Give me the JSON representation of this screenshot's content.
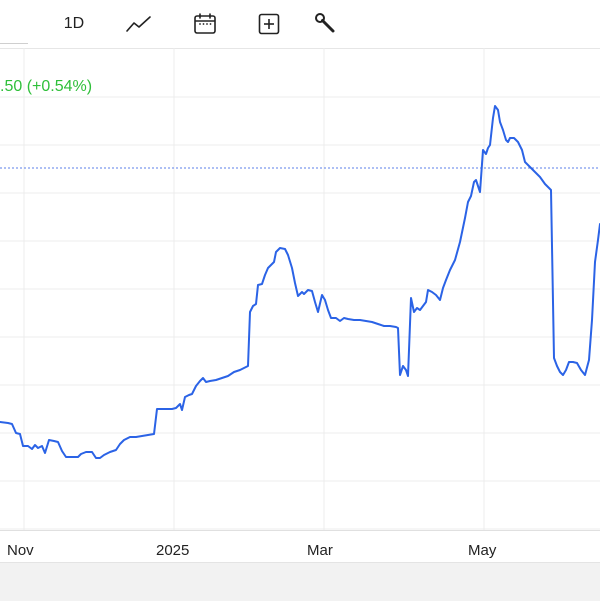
{
  "toolbar": {
    "interval_label": "1D",
    "buttons": [
      {
        "name": "line-chart-icon"
      },
      {
        "name": "calendar-icon"
      },
      {
        "name": "add-indicator-icon"
      },
      {
        "name": "wrench-icon"
      }
    ]
  },
  "price_change": ".50 (+0.54%)",
  "colors": {
    "line": "#2b63e6",
    "grid": "#ececec",
    "reference_line": "#5b7fe8",
    "change_positive": "#2fbf3a"
  },
  "chart_data": {
    "type": "line",
    "x_tick_labels": [
      "Nov",
      "2025",
      "Mar",
      "May"
    ],
    "grid": true
  }
}
